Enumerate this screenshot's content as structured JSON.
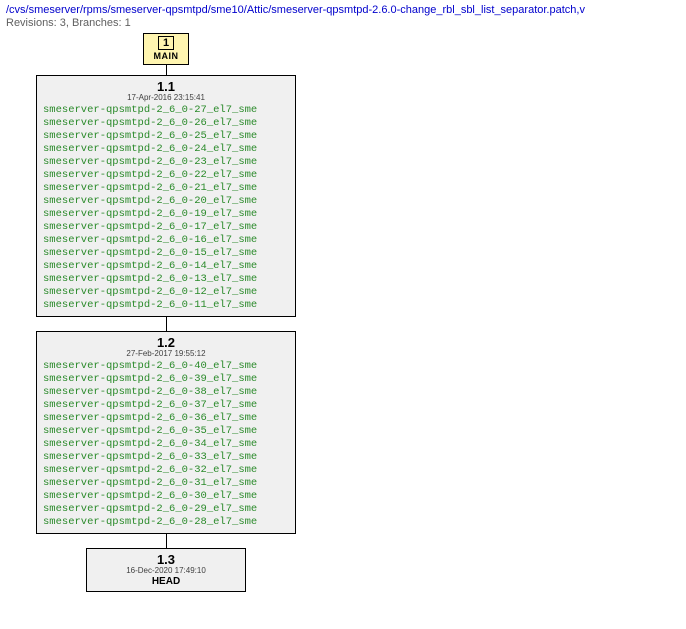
{
  "header": {
    "path": "/cvs/smeserver/rpms/smeserver-qpsmtpd/sme10/Attic/smeserver-qpsmtpd-2.6.0-change_rbl_sbl_list_separator.patch,v",
    "meta": "Revisions: 3, Branches: 1"
  },
  "branch": {
    "number": "1",
    "name": "MAIN"
  },
  "revisions": [
    {
      "num": "1.1",
      "date": "17-Apr-2016 23:15:41",
      "tags": [
        "smeserver-qpsmtpd-2_6_0-27_el7_sme",
        "smeserver-qpsmtpd-2_6_0-26_el7_sme",
        "smeserver-qpsmtpd-2_6_0-25_el7_sme",
        "smeserver-qpsmtpd-2_6_0-24_el7_sme",
        "smeserver-qpsmtpd-2_6_0-23_el7_sme",
        "smeserver-qpsmtpd-2_6_0-22_el7_sme",
        "smeserver-qpsmtpd-2_6_0-21_el7_sme",
        "smeserver-qpsmtpd-2_6_0-20_el7_sme",
        "smeserver-qpsmtpd-2_6_0-19_el7_sme",
        "smeserver-qpsmtpd-2_6_0-17_el7_sme",
        "smeserver-qpsmtpd-2_6_0-16_el7_sme",
        "smeserver-qpsmtpd-2_6_0-15_el7_sme",
        "smeserver-qpsmtpd-2_6_0-14_el7_sme",
        "smeserver-qpsmtpd-2_6_0-13_el7_sme",
        "smeserver-qpsmtpd-2_6_0-12_el7_sme",
        "smeserver-qpsmtpd-2_6_0-11_el7_sme"
      ]
    },
    {
      "num": "1.2",
      "date": "27-Feb-2017 19:55:12",
      "tags": [
        "smeserver-qpsmtpd-2_6_0-40_el7_sme",
        "smeserver-qpsmtpd-2_6_0-39_el7_sme",
        "smeserver-qpsmtpd-2_6_0-38_el7_sme",
        "smeserver-qpsmtpd-2_6_0-37_el7_sme",
        "smeserver-qpsmtpd-2_6_0-36_el7_sme",
        "smeserver-qpsmtpd-2_6_0-35_el7_sme",
        "smeserver-qpsmtpd-2_6_0-34_el7_sme",
        "smeserver-qpsmtpd-2_6_0-33_el7_sme",
        "smeserver-qpsmtpd-2_6_0-32_el7_sme",
        "smeserver-qpsmtpd-2_6_0-31_el7_sme",
        "smeserver-qpsmtpd-2_6_0-30_el7_sme",
        "smeserver-qpsmtpd-2_6_0-29_el7_sme",
        "smeserver-qpsmtpd-2_6_0-28_el7_sme"
      ]
    },
    {
      "num": "1.3",
      "date": "16-Dec-2020 17:49:10",
      "head": "HEAD"
    }
  ]
}
